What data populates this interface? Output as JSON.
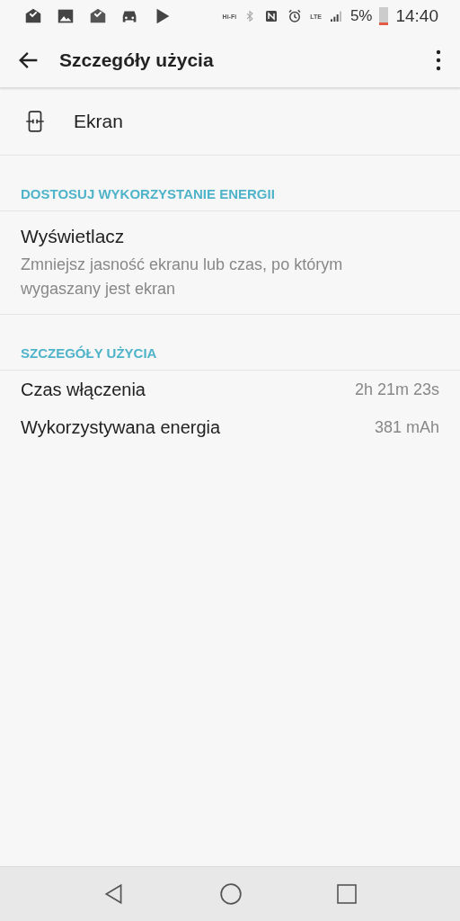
{
  "status_bar": {
    "hifi": "Hi-Fi",
    "lte": "LTE",
    "battery": "5%",
    "time": "14:40"
  },
  "app_bar": {
    "title": "Szczegóły użycia"
  },
  "app_item": {
    "label": "Ekran"
  },
  "sections": [
    {
      "header": "DOSTOSUJ WYKORZYSTANIE ENERGII",
      "items": [
        {
          "kind": "setting",
          "title": "Wyświetlacz",
          "summary": "Zmniejsz jasność ekranu lub czas, po którym wygaszany jest ekran"
        }
      ]
    },
    {
      "header": "SZCZEGÓŁY UŻYCIA",
      "items": [
        {
          "kind": "detail",
          "title": "Czas włączenia",
          "value": "2h 21m 23s"
        },
        {
          "kind": "detail",
          "title": "Wykorzystywana energia",
          "value": "381 mAh"
        }
      ]
    }
  ]
}
